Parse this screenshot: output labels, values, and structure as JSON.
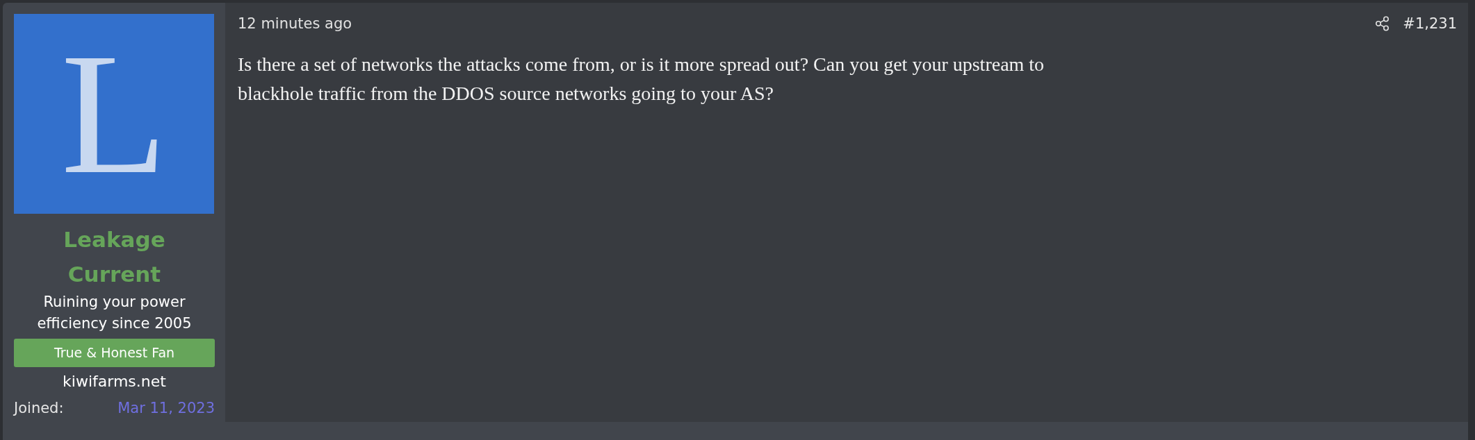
{
  "author": {
    "avatar_letter": "L",
    "name": "Leakage Current",
    "user_title": "Ruining your power efficiency since 2005",
    "banner": "True & Honest Fan",
    "extra": "kiwifarms.net",
    "joined_label": "Joined:",
    "joined_date": "Mar 11, 2023"
  },
  "post": {
    "time": "12 minutes ago",
    "number": "#1,231",
    "body": "Is there a set of networks the attacks come from, or is it more spread out? Can you get your upstream to blackhole traffic from the DDOS source networks going to your AS?"
  }
}
